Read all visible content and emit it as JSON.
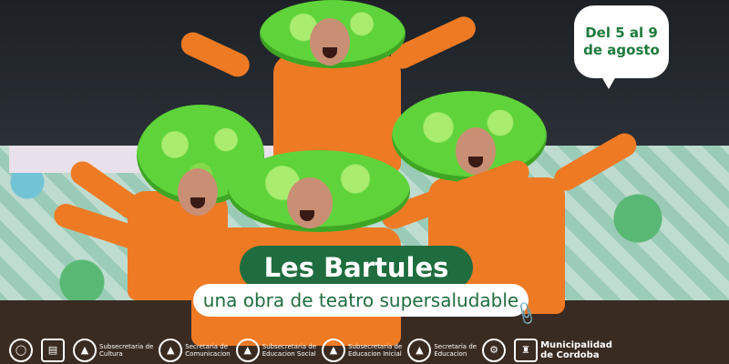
{
  "date_bubble": {
    "line1": "Del 5 al 9",
    "line2": "de agosto"
  },
  "title": "Les Bartules",
  "subtitle": "una obra de teatro supersaludable",
  "logos": [
    {
      "l1": "",
      "l2": ""
    },
    {
      "l1": "",
      "l2": ""
    },
    {
      "l1": "Subsecretaria de",
      "l2": "Cultura"
    },
    {
      "l1": "Secretaria de",
      "l2": "Comunicacion"
    },
    {
      "l1": "Subsecretaria de",
      "l2": "Educacion Social"
    },
    {
      "l1": "Subsecretaria de",
      "l2": "Educacion Inicial"
    },
    {
      "l1": "Secretaria de",
      "l2": "Educacion"
    },
    {
      "l1": "",
      "l2": ""
    },
    {
      "l1": "Municipalidad",
      "l2": "de Cordoba"
    }
  ],
  "colors": {
    "accent": "#1f6d3f",
    "orange": "#ee7a24",
    "wig_green": "#5fd33a"
  }
}
